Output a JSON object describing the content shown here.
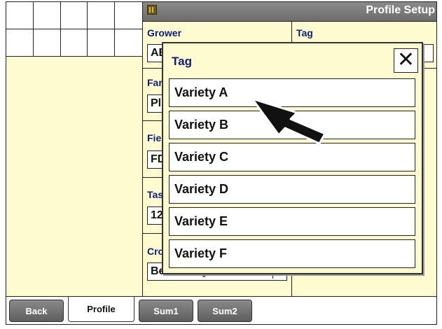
{
  "header": {
    "title": "Profile Setup",
    "icon": "app-grid-icon"
  },
  "form": {
    "grower_label": "Grower",
    "grower_value": "AB",
    "tag_label": "Tag",
    "farm_label": "Far",
    "farm_value": "Pl",
    "field_label": "Fie",
    "field_value": "FD",
    "task_label": "Tas",
    "task_value": "12",
    "crop_label": "Cro",
    "crop_value": "Beans-Soybean"
  },
  "dialog": {
    "title": "Tag",
    "close_label": "✕",
    "options": [
      "Variety A",
      "Variety B",
      "Variety C",
      "Variety D",
      "Variety E",
      "Variety F"
    ]
  },
  "tabs": {
    "back": "Back",
    "profile": "Profile",
    "sum1": "Sum1",
    "sum2": "Sum2"
  },
  "colors": {
    "panel": "#fffbd0",
    "label": "#0b1e78",
    "titlebar": "#6d6d6d"
  }
}
